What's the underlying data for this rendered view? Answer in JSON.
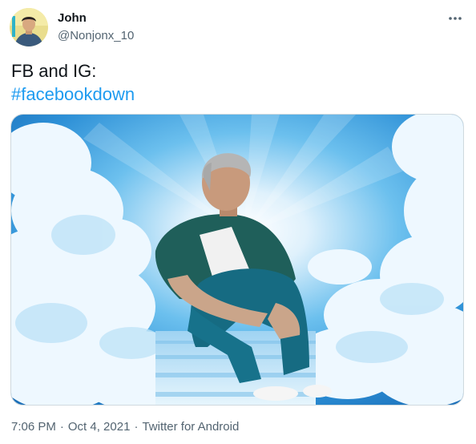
{
  "user": {
    "display_name": "John",
    "handle": "@Nonjonx_10"
  },
  "tweet": {
    "text": "FB and IG:",
    "hashtag": "#facebookdown"
  },
  "meta": {
    "time": "7:06 PM",
    "separator": "·",
    "date": "Oct 4, 2021",
    "source": "Twitter for Android"
  },
  "icons": {
    "more": "more-horizontal-icon"
  },
  "colors": {
    "link": "#1d9bf0",
    "secondary_text": "#536471",
    "sky": "#2c8fd6"
  }
}
